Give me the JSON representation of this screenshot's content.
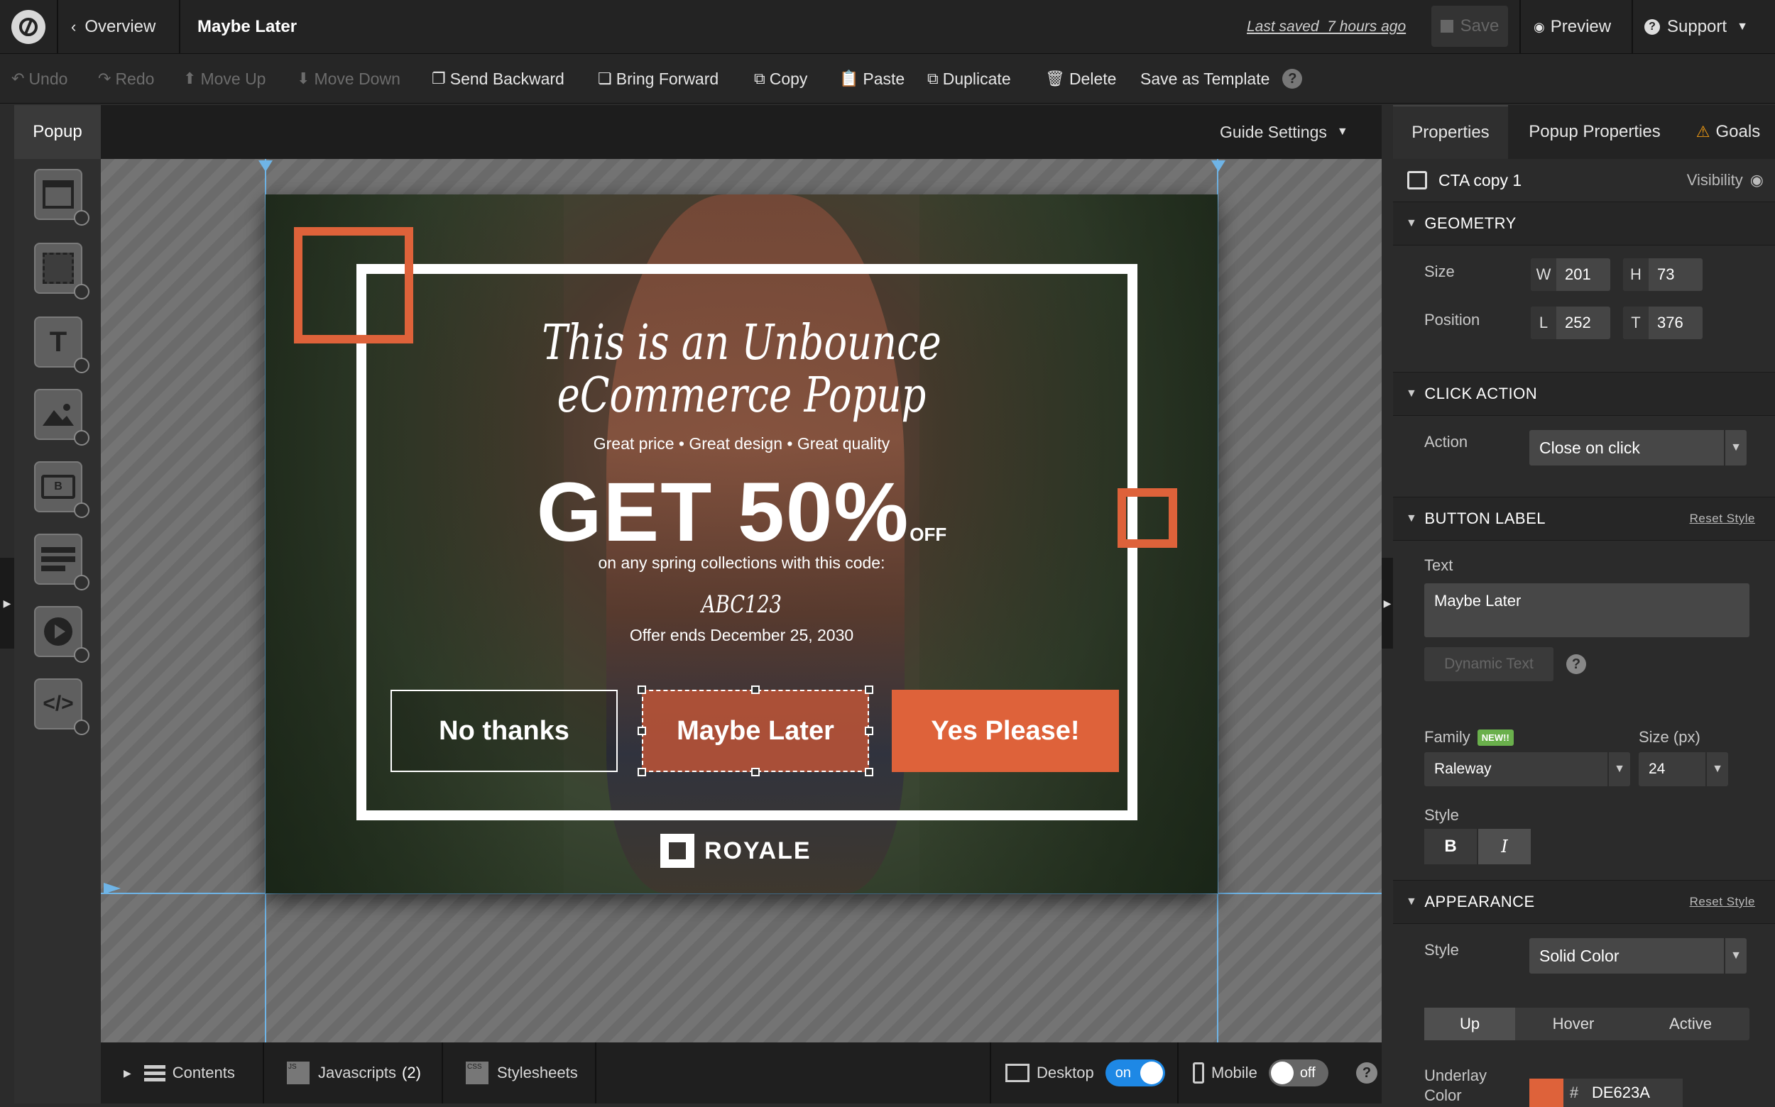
{
  "topbar": {
    "overview": "Overview",
    "page_name": "Maybe Later",
    "last_saved": "Last saved  7 hours ago",
    "save": "Save",
    "preview": "Preview",
    "support": "Support"
  },
  "toolbar": {
    "undo": "Undo",
    "redo": "Redo",
    "move_up": "Move Up",
    "move_down": "Move Down",
    "send_backward": "Send Backward",
    "bring_forward": "Bring Forward",
    "copy": "Copy",
    "paste": "Paste",
    "duplicate": "Duplicate",
    "delete": "Delete",
    "save_template": "Save as Template"
  },
  "left_panel": {
    "tab": "Popup",
    "tools": [
      "box-tool-icon",
      "section-tool-icon",
      "text-tool-icon",
      "image-tool-icon",
      "button-tool-icon",
      "form-tool-icon",
      "video-tool-icon",
      "code-tool-icon"
    ]
  },
  "canvas": {
    "guide_settings": "Guide Settings",
    "popup": {
      "headline_1": "This is an Unbounce",
      "headline_2": "eCommerce Popup",
      "tagline": "Great price • Great design • Great quality",
      "offer_big": "GET 50%",
      "offer_small": "OFF",
      "subline": "on any spring collections with this code:",
      "code": "ABC123",
      "ends": "Offer ends December 25, 2030",
      "btn_no": "No thanks",
      "btn_maybe": "Maybe Later",
      "btn_yes": "Yes Please!",
      "brand": "ROYALE"
    }
  },
  "bottombar": {
    "contents": "Contents",
    "javascripts": "Javascripts",
    "javascripts_count": "(2)",
    "stylesheets": "Stylesheets",
    "desktop": "Desktop",
    "desktop_toggle": "on",
    "mobile": "Mobile",
    "mobile_toggle": "off"
  },
  "right_panel": {
    "tabs": [
      "Properties",
      "Popup Properties",
      "Goals"
    ],
    "element_name": "CTA copy 1",
    "visibility": "Visibility",
    "geometry": {
      "title": "GEOMETRY",
      "size_label": "Size",
      "w_prefix": "W",
      "w": "201",
      "h_prefix": "H",
      "h": "73",
      "position_label": "Position",
      "l_prefix": "L",
      "l": "252",
      "t_prefix": "T",
      "t": "376"
    },
    "click_action": {
      "title": "CLICK ACTION",
      "action_label": "Action",
      "action_value": "Close on click"
    },
    "button_label": {
      "title": "BUTTON LABEL",
      "reset": "Reset Style",
      "text_label": "Text",
      "text_value": "Maybe Later",
      "dynamic_text": "Dynamic Text",
      "family_label": "Family",
      "new_badge": "NEW!!",
      "family_value": "Raleway",
      "size_label": "Size (px)",
      "size_value": "24",
      "style_label": "Style",
      "bold": "B",
      "italic": "I"
    },
    "appearance": {
      "title": "APPEARANCE",
      "reset": "Reset Style",
      "style_label": "Style",
      "style_value": "Solid Color",
      "states": [
        "Up",
        "Hover",
        "Active"
      ],
      "underlay_label": "Underlay",
      "color_label": "Color",
      "hash": "#",
      "color_value": "DE623A"
    }
  },
  "colors": {
    "accent": "#de623a",
    "toggle_on": "#1e88e5"
  }
}
